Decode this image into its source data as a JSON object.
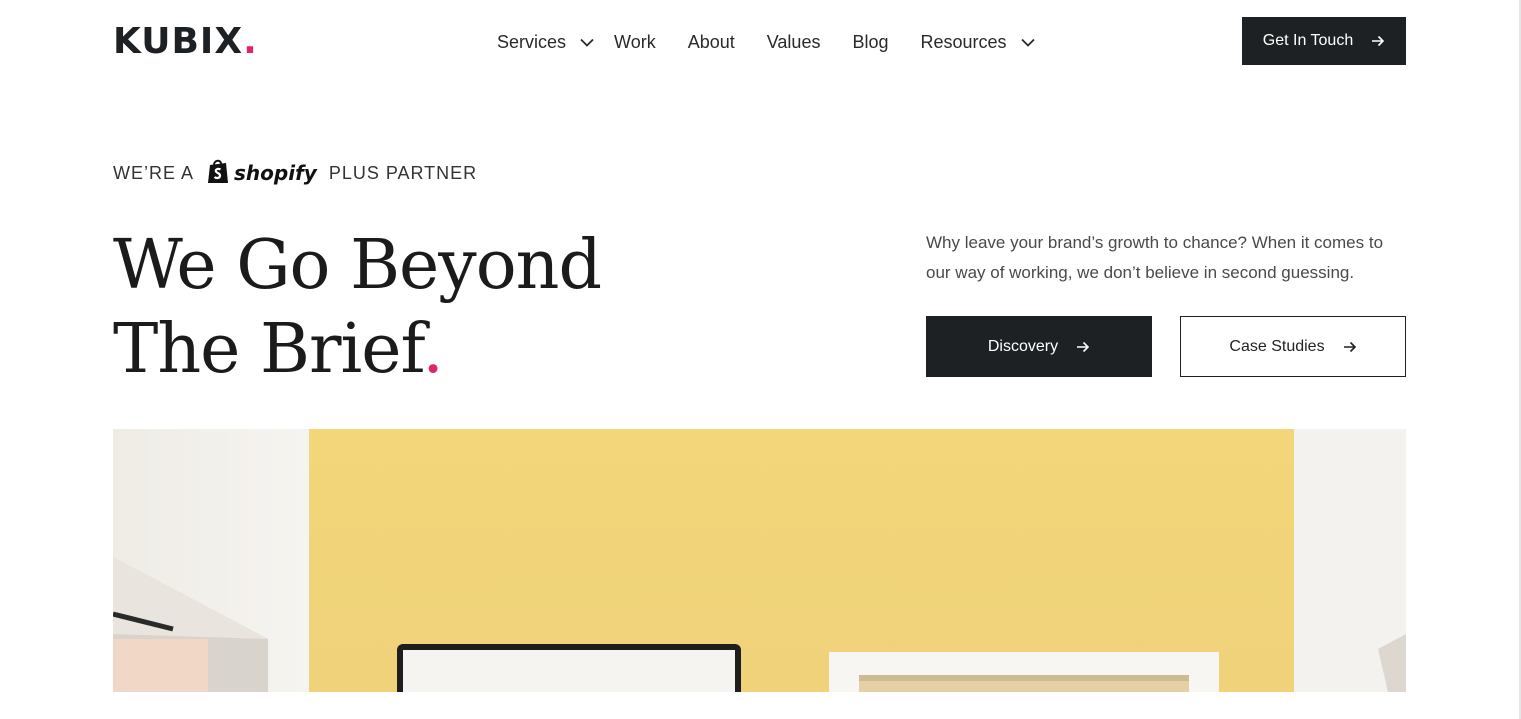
{
  "header": {
    "logo_text": "KUBIX",
    "logo_dot": ".",
    "nav": {
      "services": "Services",
      "work": "Work",
      "about": "About",
      "values": "Values",
      "blog": "Blog",
      "resources": "Resources"
    },
    "cta_label": "Get In Touch"
  },
  "partner": {
    "prefix": "WE’RE A",
    "brand": "shopify",
    "suffix": "PLUS PARTNER"
  },
  "hero": {
    "headline_line1": "We Go Beyond",
    "headline_line2": "The Brief",
    "headline_dot": ".",
    "tagline": "Why leave your brand’s growth to chance? When it comes to our way of working, we don’t believe in second guessing.",
    "primary_button": "Discovery",
    "secondary_button": "Case Studies"
  },
  "icons": {
    "services_dropdown": "chevron-down-icon",
    "resources_dropdown": "chevron-down-icon",
    "arrow": "arrow-right-icon",
    "shopify_bag": "shopify-bag-icon"
  },
  "colors": {
    "accent": "#e0246e",
    "dark": "#1e2124",
    "hero_wall": "#f1d77d"
  }
}
